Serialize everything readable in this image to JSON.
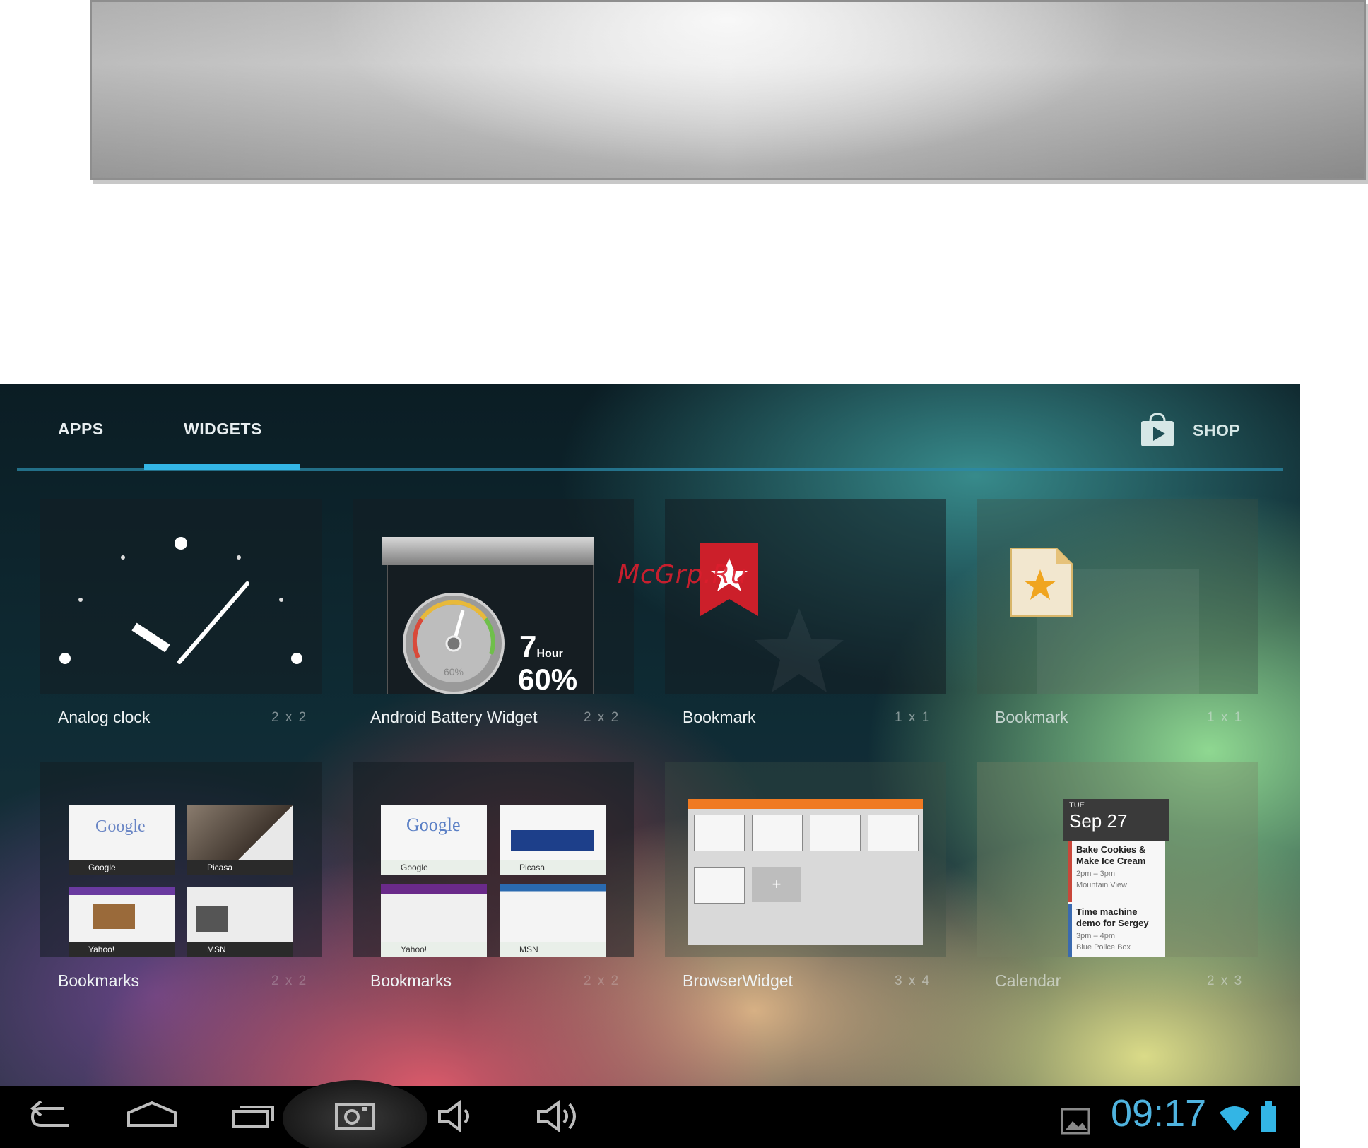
{
  "tabs": {
    "apps": "APPS",
    "widgets": "WIDGETS",
    "active": "WIDGETS"
  },
  "shop": {
    "label": "SHOP"
  },
  "widgets": [
    {
      "name": "Analog clock",
      "size": "2 x 2"
    },
    {
      "name": "Android Battery Widget",
      "size": "2 x 2",
      "battery": {
        "hours": "7",
        "hours_unit": "Hour",
        "percent": "60%",
        "gauge": "60%"
      }
    },
    {
      "name": "Bookmark",
      "size": "1 x 1"
    },
    {
      "name": "Bookmark",
      "size": "1 x 1"
    },
    {
      "name": "Bookmarks",
      "size": "2 x 2",
      "thumbs": [
        "Google",
        "Picasa",
        "Yahoo!",
        "MSN"
      ]
    },
    {
      "name": "Bookmarks",
      "size": "2 x 2",
      "thumbs": [
        "Google",
        "Picasa",
        "Yahoo!",
        "MSN"
      ]
    },
    {
      "name": "BrowserWidget",
      "size": "3 x 4"
    },
    {
      "name": "Calendar",
      "size": "2 x 3",
      "calendar": {
        "day": "TUE",
        "date": "Sep 27",
        "events": [
          {
            "title": "Bake Cookies & Make Ice Cream",
            "time": "2pm – 3pm",
            "place": "Mountain View"
          },
          {
            "title": "Time machine demo for Sergey",
            "time": "3pm – 4pm",
            "place": "Blue Police Box"
          }
        ]
      }
    }
  ],
  "status_bar": {
    "time": "09:17"
  },
  "watermark": "McGrp.Ru",
  "colors": {
    "accent": "#33b5e5",
    "clock": "#4fb3df"
  }
}
